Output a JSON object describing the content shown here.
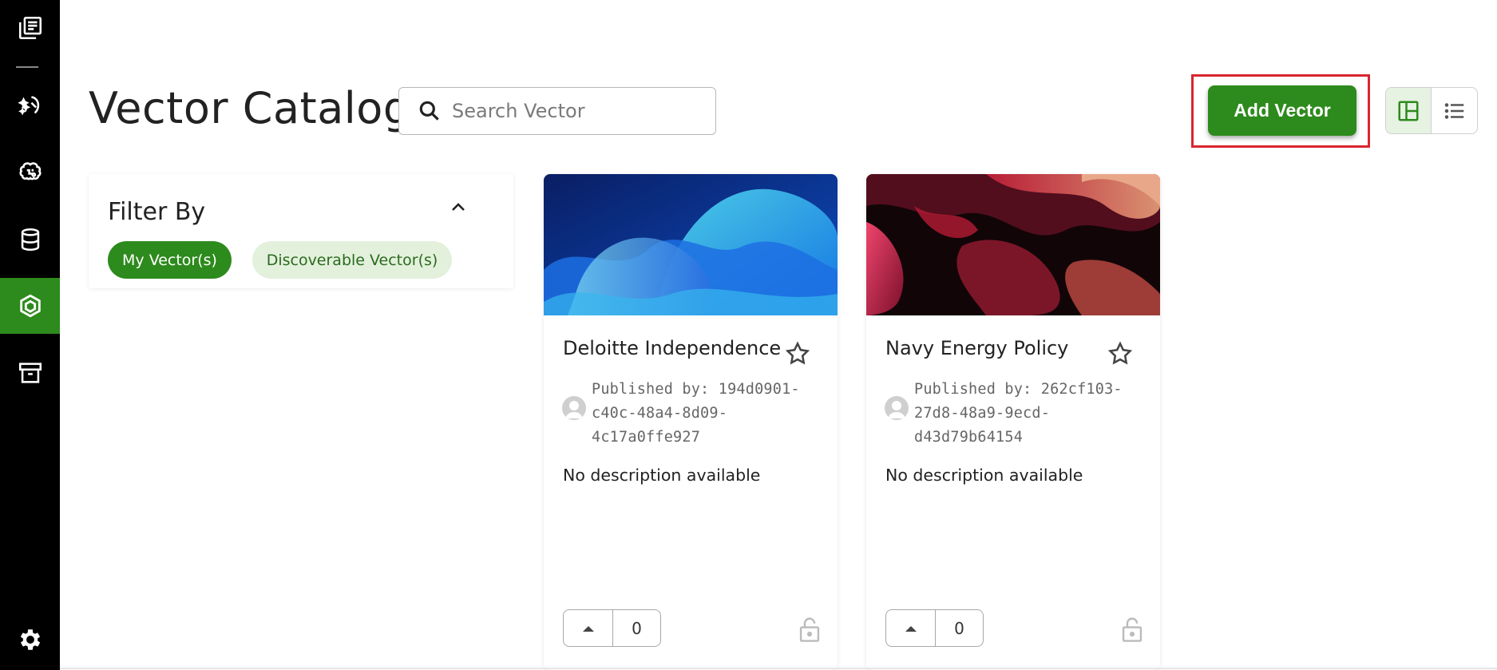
{
  "sidebar": {
    "items": [
      {
        "icon": "library-icon"
      },
      {
        "icon": "magic-wand-icon"
      },
      {
        "icon": "brain-icon"
      },
      {
        "icon": "database-icon"
      },
      {
        "icon": "vector-cube-icon",
        "active": true
      },
      {
        "icon": "archive-icon"
      }
    ],
    "settings_icon": "gear-icon"
  },
  "header": {
    "title": "Vector Catalog",
    "search_placeholder": "Search Vector",
    "add_button_label": "Add Vector",
    "views": [
      "grid-view-icon",
      "list-view-icon"
    ],
    "active_view": "grid"
  },
  "filter": {
    "title": "Filter By",
    "chips": [
      {
        "label": "My Vector(s)",
        "selected": true
      },
      {
        "label": "Discoverable Vector(s)",
        "selected": false
      }
    ]
  },
  "cards": [
    {
      "title": "Deloitte Independence",
      "published_by": "Published by: 194d0901-c40c-48a4-8d09-4c17a0ffe927",
      "description": "No description available",
      "votes": "0"
    },
    {
      "title": "Navy Energy Policy",
      "published_by": "Published by: 262cf103-27d8-48a9-9ecd-d43d79b64154",
      "description": "No description available",
      "votes": "0"
    }
  ],
  "colors": {
    "accent": "#2d8a1c",
    "sidebar_bg": "#000000",
    "highlight": "#d9252f",
    "chip_light": "#e3f1dc"
  }
}
